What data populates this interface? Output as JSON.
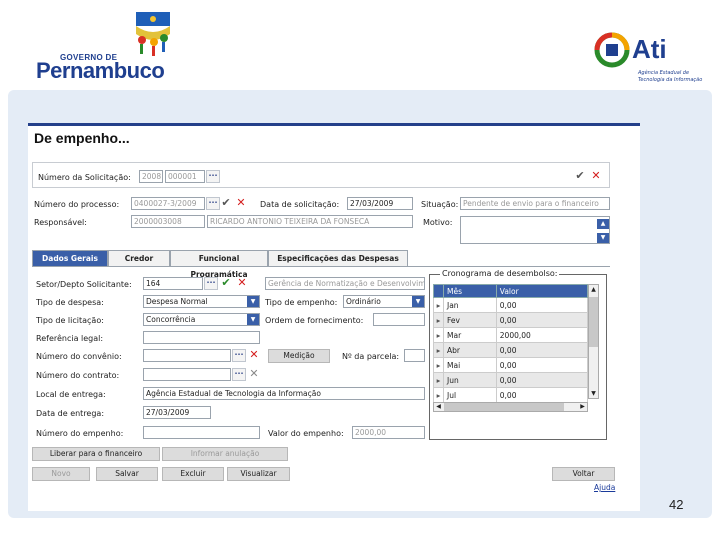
{
  "page_number": "42",
  "logos": {
    "pe_top": "GOVERNO DE",
    "pe_main": "Pernambuco",
    "ati_main": "Ati",
    "ati_sub1": "Agência Estadual de",
    "ati_sub2": "Tecnologia da Informação"
  },
  "form": {
    "title": "De empenho...",
    "solicitacao": {
      "label": "Número da Solicitação:",
      "year": "2008",
      "number": "000001"
    },
    "processo": {
      "label": "Número do processo:",
      "value": "0400027-3/2009"
    },
    "data_solicitacao": {
      "label": "Data de solicitação:",
      "value": "27/03/2009"
    },
    "situacao": {
      "label": "Situação:",
      "value": "Pendente de envio para o financeiro"
    },
    "responsavel": {
      "label": "Responsável:",
      "code": "2000003008",
      "name": "RICARDO ANTONIO TEIXEIRA DA FONSECA"
    },
    "motivo": {
      "label": "Motivo:"
    },
    "tabs": [
      "Dados Gerais",
      "Credor",
      "Funcional Programática",
      "Especificações das Despesas"
    ],
    "setor": {
      "label": "Setor/Depto Solicitante:",
      "code": "164",
      "name": "Gerência de Normatização e Desenvolvimento"
    },
    "tipo_despesa": {
      "label": "Tipo de despesa:",
      "value": "Despesa Normal"
    },
    "tipo_empenho": {
      "label": "Tipo de empenho:",
      "value": "Ordinário"
    },
    "tipo_licitacao": {
      "label": "Tipo de licitação:",
      "value": "Concorrência"
    },
    "ordem_fornecimento": {
      "label": "Ordem de fornecimento:"
    },
    "referencia_legal": {
      "label": "Referência legal:"
    },
    "numero_convenio": {
      "label": "Número do convênio:"
    },
    "medicao_button": "Medição",
    "numero_parcela": {
      "label": "Nº da parcela:"
    },
    "numero_contrato": {
      "label": "Número do contrato:"
    },
    "local_entrega": {
      "label": "Local de entrega:",
      "value": "Agência Estadual de Tecnologia da Informação"
    },
    "data_entrega": {
      "label": "Data de entrega:",
      "value": "27/03/2009"
    },
    "numero_empenho": {
      "label": "Número do empenho:"
    },
    "valor_empenho": {
      "label": "Valor do empenho:",
      "value": "2000,00"
    },
    "cronograma": {
      "title": "Cronograma de desembolso:",
      "headers": [
        "Mês",
        "Valor"
      ],
      "rows": [
        {
          "mes": "Jan",
          "valor": "0,00"
        },
        {
          "mes": "Fev",
          "valor": "0,00"
        },
        {
          "mes": "Mar",
          "valor": "2000,00"
        },
        {
          "mes": "Abr",
          "valor": "0,00"
        },
        {
          "mes": "Mai",
          "valor": "0,00"
        },
        {
          "mes": "Jun",
          "valor": "0,00"
        },
        {
          "mes": "Jul",
          "valor": "0,00"
        }
      ]
    },
    "buttons": {
      "liberar": "Liberar para o financeiro",
      "informar_anulacao": "Informar anulação",
      "novo": "Novo",
      "salvar": "Salvar",
      "excluir": "Excluir",
      "visualizar": "Visualizar",
      "voltar": "Voltar"
    },
    "ajuda_link": "Ajuda"
  }
}
